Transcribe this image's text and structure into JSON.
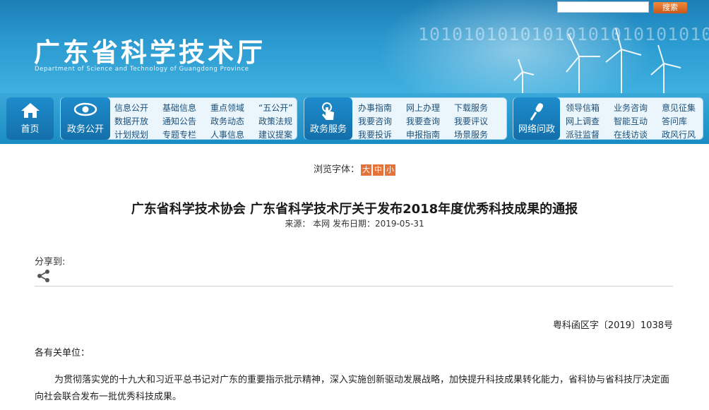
{
  "header": {
    "site_title": "广东省科学技术厅",
    "site_subtitle": "Department of Science and Technology of Guangdong Province",
    "binary_decoration": "1010101010101010101010101010",
    "search_placeholder": "",
    "search_button": "搜索"
  },
  "nav": {
    "home": "首页",
    "gov_open": {
      "title": "政务公开",
      "links": [
        "信息公开",
        "基础信息",
        "重点领域",
        "“五公开”",
        "数据开放",
        "通知公告",
        "政务动态",
        "政策法规",
        "计划规划",
        "专题专栏",
        "人事信息",
        "建议提案"
      ]
    },
    "gov_service": {
      "title": "政务服务",
      "links": [
        "办事指南",
        "网上办理",
        "下载服务",
        "我要咨询",
        "我要查询",
        "我要评议",
        "我要投诉",
        "申报指南",
        "场景服务"
      ]
    },
    "interaction": {
      "title": "网络问政",
      "links": [
        "领导信箱",
        "业务咨询",
        "意见征集",
        "网上调查",
        "智能互动",
        "答问库",
        "派驻监督",
        "在线访谈",
        "政风行风"
      ]
    }
  },
  "article": {
    "font_label": "浏览字体：",
    "font_sizes": [
      "大",
      "中",
      "小"
    ],
    "title": "广东省科学技术协会  广东省科学技术厅关于发布2018年度优秀科技成果的通报",
    "meta": "来源：  本网   发布日期：2019-05-31",
    "share_label": "分享到:",
    "doc_number": "粤科函区字〔2019〕1038号",
    "greeting": "各有关单位：",
    "body": "为贯彻落实党的十九大和习近平总书记对广东的重要指示批示精神，深入实施创新驱动发展战略，加快提升科技成果转化能力，省科协与省科技厅决定面向社会联合发布一批优秀科技成果。"
  },
  "colors": {
    "banner_top": "#1d7fb6",
    "nav_tile": "#1d8ccd",
    "accent_orange": "#e3733a"
  }
}
